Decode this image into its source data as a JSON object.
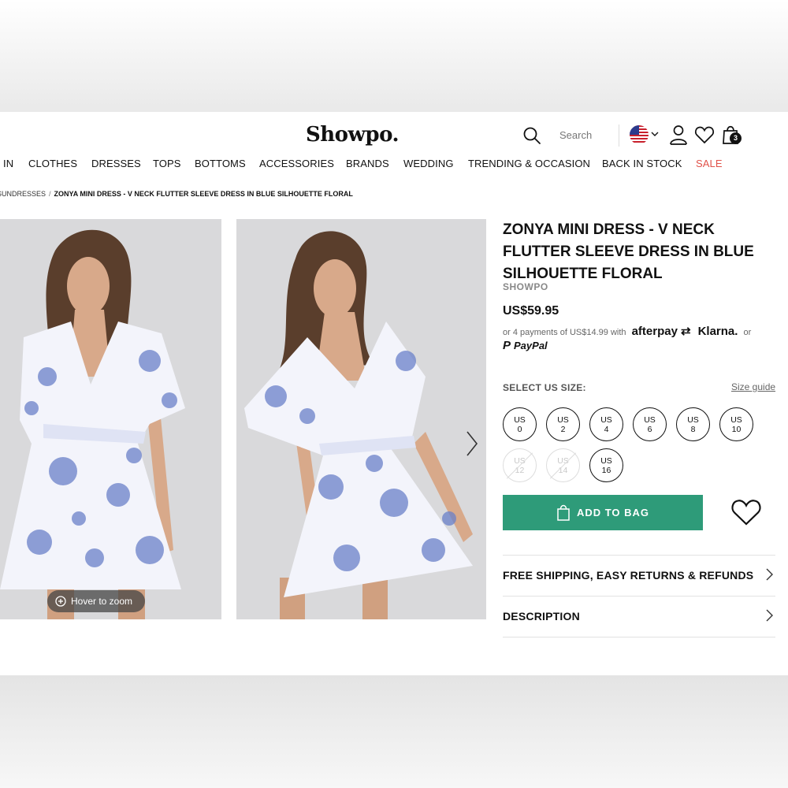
{
  "header": {
    "logo": "Showpo.",
    "search_placeholder": "Search",
    "cart_count": "3"
  },
  "nav": {
    "items": [
      "IN",
      "CLOTHES",
      "DRESSES",
      "TOPS",
      "BOTTOMS",
      "ACCESSORIES",
      "BRANDS",
      "WEDDING",
      "TRENDING & OCCASION",
      "BACK IN STOCK",
      "SALE"
    ],
    "sale_color": "#e0524a"
  },
  "breadcrumb": {
    "parent": "SUNDRESSES",
    "separator": "/",
    "current": "ZONYA MINI DRESS - V NECK FLUTTER SLEEVE DRESS IN BLUE SILHOUETTE FLORAL"
  },
  "gallery": {
    "zoom_hint": "Hover to zoom"
  },
  "product": {
    "title": "ZONYA MINI DRESS - V NECK FLUTTER SLEEVE DRESS IN BLUE SILHOUETTE FLORAL",
    "brand": "SHOWPO",
    "price": "US$59.95",
    "installments_prefix": "or 4 payments of US$14.99 with",
    "afterpay": "afterpay",
    "klarna": "Klarna.",
    "or_text": "or",
    "paypal": "PayPal",
    "size_label": "SELECT US SIZE:",
    "size_guide": "Size guide",
    "sizes": [
      {
        "line1": "US",
        "line2": "0",
        "available": true
      },
      {
        "line1": "US",
        "line2": "2",
        "available": true
      },
      {
        "line1": "US",
        "line2": "4",
        "available": true
      },
      {
        "line1": "US",
        "line2": "6",
        "available": true
      },
      {
        "line1": "US",
        "line2": "8",
        "available": true
      },
      {
        "line1": "US",
        "line2": "10",
        "available": true
      },
      {
        "line1": "US",
        "line2": "12",
        "available": false
      },
      {
        "line1": "US",
        "line2": "14",
        "available": false
      },
      {
        "line1": "US",
        "line2": "16",
        "available": true
      }
    ],
    "add_to_bag": "ADD TO BAG",
    "accent_color": "#2e9b79",
    "accordion": [
      "FREE SHIPPING, EASY RETURNS & REFUNDS",
      "DESCRIPTION"
    ]
  }
}
